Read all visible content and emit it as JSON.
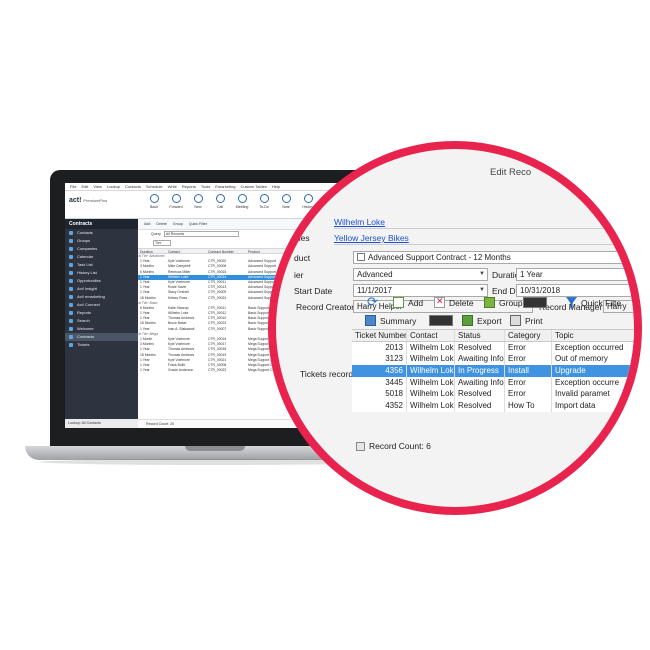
{
  "mini_app": {
    "menu": [
      "File",
      "Edit",
      "View",
      "Lookup",
      "Contacts",
      "Schedule",
      "Write",
      "Reports",
      "Tools",
      "Emarketing",
      "Custom Tables",
      "Help"
    ],
    "logo": "act!",
    "edition": "PremiumPlus",
    "toolbar": [
      "Back",
      "Forward",
      "New",
      "Call",
      "Meeting",
      "To-Do",
      "Note",
      "History",
      "E-mail"
    ],
    "sidebar_title": "Contracts",
    "nav": [
      "Contacts",
      "Groups",
      "Companies",
      "Calendar",
      "Task List",
      "History List",
      "Opportunities",
      "Act! Insight",
      "Act! emarketing",
      "Act! Connect",
      "Reports",
      "Search",
      "Welcome",
      "Contracts",
      "Tickets"
    ],
    "nav_selected": "Contracts",
    "subbar": [
      "Add",
      "Delete",
      "Group",
      "Quick Filter"
    ],
    "query_label": "Query",
    "query_value": "All Records",
    "tier_label": "Tier",
    "columns": [
      "Duration",
      "Contact",
      "Contract Number",
      "Product"
    ],
    "rows": [
      {
        "g": "Tier: Advanced"
      },
      {
        "d": "1 Year",
        "c": "Kyle Voelmore",
        "n": "CTR_00020",
        "p": "Advanced Support"
      },
      {
        "d": "3 Months",
        "c": "Mike Campbell",
        "n": "CTR_00006",
        "p": "Advanced Support"
      },
      {
        "d": "6 Months",
        "c": "Rebecca Miller",
        "n": "CTR_00015",
        "p": "Advanced Support"
      },
      {
        "d": "1 Year",
        "c": "Wilhelm Loke",
        "n": "CTR_00014",
        "p": "Advanced Support",
        "sel": true
      },
      {
        "d": "1 Year",
        "c": "Kyle Voelmore",
        "n": "CTR_00011",
        "p": "Advanced Support"
      },
      {
        "d": "1 Year",
        "c": "Rosie Saver",
        "n": "CTR_00013",
        "p": "Advanced Support"
      },
      {
        "d": "1 Year",
        "c": "Stacy Ovshell",
        "n": "CTR_00009",
        "p": "Advanced Support"
      },
      {
        "d": "18 Months",
        "c": "Kelsey Rosa",
        "n": "CTR_00024",
        "p": "Advanced Support"
      },
      {
        "g": "Tier: Basic"
      },
      {
        "d": "6 Months",
        "c": "Katie Stanrup",
        "n": "CTR_00011",
        "p": "Basic Support Contract"
      },
      {
        "d": "1 Year",
        "c": "Wilhelm Loke",
        "n": "CTR_00012",
        "p": "Basic Support Contract"
      },
      {
        "d": "1 Year",
        "c": "Thomas Andrews",
        "n": "CTR_00010",
        "p": "Basic Support Contract"
      },
      {
        "d": "18 Months",
        "c": "Bruce Baker",
        "n": "CTR_00022",
        "p": "Basic Support Contract"
      },
      {
        "d": "1 Year",
        "c": "Ivan A. Stakaandi",
        "n": "CTR_00007",
        "p": "Basic Support Contract"
      },
      {
        "g": "Tier: Mega"
      },
      {
        "d": "1 Month",
        "c": "Kyle Voelmore",
        "n": "CTR_00016",
        "p": "Mega Support Contract"
      },
      {
        "d": "3 Months",
        "c": "Kyle Voelmore",
        "n": "CTR_00017",
        "p": "Mega Support Contract"
      },
      {
        "d": "1 Year",
        "c": "Thomas Andrews",
        "n": "CTR_00018",
        "p": "Mega Support Contract"
      },
      {
        "d": "18 Months",
        "c": "Thomas Andrews",
        "n": "CTR_00019",
        "p": "Mega Support Contract"
      },
      {
        "d": "1 Year",
        "c": "Kyle Voelmore",
        "n": "CTR_00021",
        "p": "Mega Support Contract"
      },
      {
        "d": "1 Year",
        "c": "Frank Bullit",
        "n": "CTR_00008",
        "p": "Mega Support Contract - 12"
      },
      {
        "d": "1 Year",
        "c": "Gracie Anderson",
        "n": "CTR_00023",
        "p": "Mega Support Contract - 6"
      }
    ],
    "record_count": "Record Count: 20",
    "lookup": "Lookup: All Contacts"
  },
  "detail": {
    "window_title": "Edit Reco",
    "contact_link": "Wilhelm Loke",
    "companies_label": "nies",
    "company_link": "Yellow Jersey Bikes",
    "product_label": "duct",
    "product_value": "Advanced Support Contract - 12 Months",
    "tier_label": "ier",
    "tier_value": "Advanced",
    "duration_label": "Duration",
    "duration_value": "1 Year",
    "start_label": "Start Date",
    "start_value": "11/1/2017",
    "end_label": "End Date",
    "end_value": "10/31/2018",
    "creator_label": "Record Creator",
    "creator_value": "Harry Helper",
    "manager_label": "Record Manager",
    "manager_value": "Harry",
    "tickets_label": "Tickets records",
    "toolbar": {
      "add": "Add",
      "delete": "Delete",
      "group": "Group",
      "quick_filter": "Quick Filte",
      "summary": "Summary",
      "export": "Export",
      "print": "Print"
    },
    "grid": {
      "columns": [
        "Ticket Number",
        "Contact",
        "Status",
        "Category",
        "Topic"
      ],
      "rows": [
        [
          "2013",
          "Wilhelm Loke",
          "Resolved",
          "Error",
          "Exception occurred"
        ],
        [
          "3123",
          "Wilhelm Loke",
          "Awaiting Info",
          "Error",
          "Out of memory"
        ],
        [
          "4356",
          "Wilhelm Loke",
          "In Progress",
          "Install",
          "Upgrade"
        ],
        [
          "3445",
          "Wilhelm Loke",
          "Awaiting Info",
          "Error",
          "Exception occurre"
        ],
        [
          "5018",
          "Wilhelm Loke",
          "Resolved",
          "Error",
          "Invalid paramet"
        ],
        [
          "4352",
          "Wilhelm Loke",
          "Resolved",
          "How To",
          "Import data"
        ]
      ],
      "selected_index": 2
    },
    "record_count": "Record Count: 6"
  },
  "colors": {
    "lens_ring": "#e8234e",
    "selection": "#3f93e0",
    "sidebar": "#2d3440",
    "link": "#1a4fd1"
  }
}
